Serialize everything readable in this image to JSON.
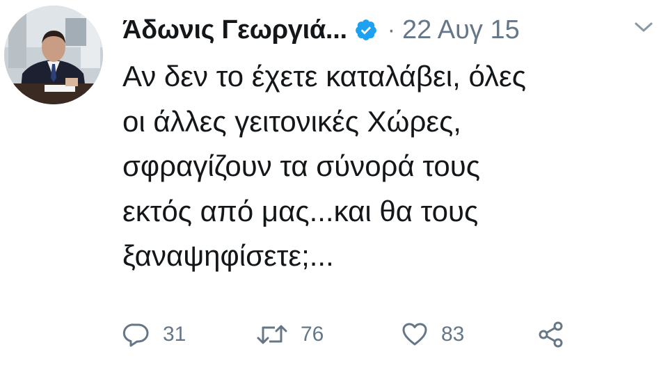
{
  "tweet": {
    "display_name": "Άδωνις Γεωργιά...",
    "separator": "·",
    "date": "22 Αυγ 15",
    "text_lines": [
      "Αν δεν το έχετε καταλάβει, όλες",
      "οι άλλες γειτονικές Χώρες,",
      "σφραγίζουν τα σύνορά τους",
      "εκτός από μας...και θα τους",
      "ξαναψηφίσετε;..."
    ],
    "actions": {
      "replies": "31",
      "retweets": "76",
      "likes": "83"
    }
  },
  "colors": {
    "text": "#14171a",
    "secondary": "#657786",
    "verified": "#1da1f2"
  },
  "icons": {
    "verified": "verified-badge-icon",
    "menu": "chevron-down-icon",
    "reply": "reply-icon",
    "retweet": "retweet-icon",
    "like": "heart-icon",
    "share": "share-icon"
  }
}
